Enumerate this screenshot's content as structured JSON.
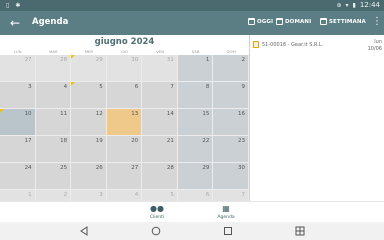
{
  "statusbar": {
    "clock": "12:44"
  },
  "toolbar": {
    "title": "Agenda",
    "buttons": [
      {
        "label": "OGGI"
      },
      {
        "label": "DOMANI"
      },
      {
        "label": "SETTIMANA"
      }
    ]
  },
  "calendar": {
    "month_label": "giugno 2024",
    "weekdays": [
      "LUN",
      "MAR",
      "MER",
      "GIO",
      "VEN",
      "SAB",
      "DOM"
    ],
    "weeks": [
      [
        "27",
        "28",
        "29",
        "30",
        "31",
        "1",
        "2"
      ],
      [
        "3",
        "4",
        "5",
        "6",
        "7",
        "8",
        "9"
      ],
      [
        "10",
        "11",
        "12",
        "13",
        "14",
        "15",
        "16"
      ],
      [
        "17",
        "18",
        "19",
        "20",
        "21",
        "22",
        "23"
      ],
      [
        "24",
        "25",
        "26",
        "27",
        "28",
        "29",
        "30"
      ],
      [
        "1",
        "2",
        "3",
        "4",
        "5",
        "6",
        "7"
      ]
    ],
    "today": "13"
  },
  "agenda": {
    "items": [
      {
        "text": "51-00018 - Gear.it S.R.L.",
        "day": "lun",
        "date": "10/06"
      }
    ]
  },
  "tabs": [
    {
      "label": "Clienti"
    },
    {
      "label": "Agenda"
    }
  ]
}
